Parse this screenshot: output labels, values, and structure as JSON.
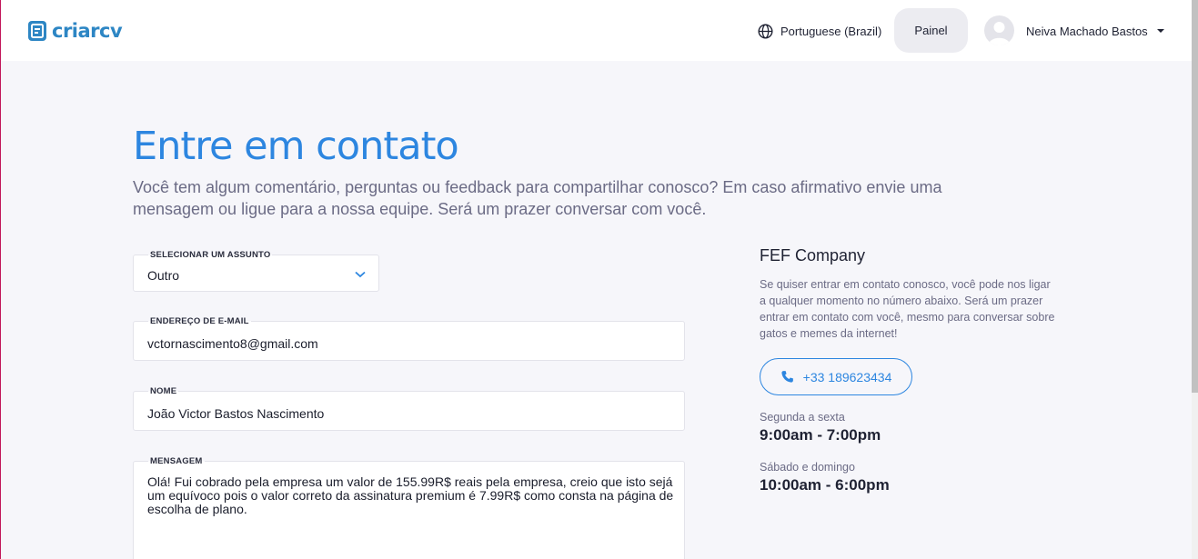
{
  "header": {
    "logo_text": "criarcv",
    "language": "Portuguese (Brazil)",
    "panel_label": "Painel",
    "user_name": "Neiva Machado Bastos"
  },
  "page": {
    "title": "Entre em contato",
    "subtitle": "Você tem algum comentário, perguntas ou feedback para compartilhar conosco? Em caso afirmativo envie uma mensagem ou ligue para a nossa equipe. Será um prazer conversar com você."
  },
  "form": {
    "subject_label": "SELECIONAR UM ASSUNTO",
    "subject_value": "Outro",
    "email_label": "ENDEREÇO DE E-MAIL",
    "email_value": "vctornascimento8@gmail.com",
    "name_label": "NOME",
    "name_value": "João Victor Bastos Nascimento",
    "message_label": "MENSAGEM",
    "message_value": "Olá! Fui cobrado pela empresa um valor de 155.99R$ reais pela empresa, creio que isto sejá um equívoco pois o valor correto da assinatura premium é 7.99R$ como consta na página de escolha de plano."
  },
  "contact": {
    "company": "FEF Company",
    "description": "Se quiser entrar em contato conosco, você pode nos ligar a qualquer momento no número abaixo. Será um prazer entrar em contato com você, mesmo para conversar sobre gatos e memes da internet!",
    "phone": "+33 189623434",
    "weekday_label": "Segunda a sexta",
    "weekday_hours": "9:00am - 7:00pm",
    "weekend_label": "Sábado e domingo",
    "weekend_hours": "10:00am - 6:00pm"
  },
  "icons": {
    "logo": "document-icon",
    "language": "globe-icon",
    "select": "chevron-down-icon",
    "phone": "phone-icon",
    "user": "avatar-icon"
  },
  "colors": {
    "brand": "#2d86c4",
    "accent": "#2d86e0",
    "background": "#f6f6fa"
  }
}
